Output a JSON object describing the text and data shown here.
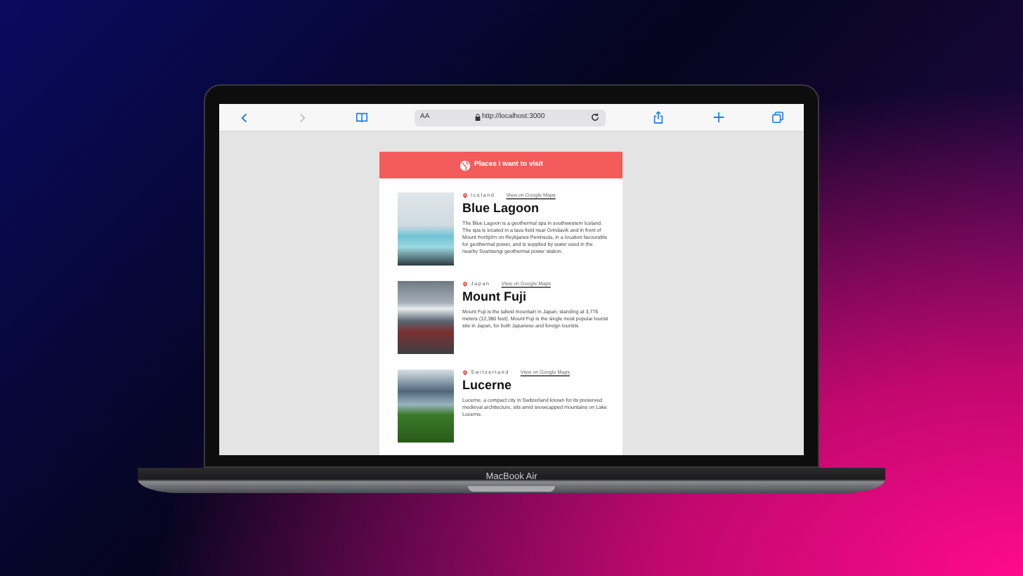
{
  "browser": {
    "back_disabled": false,
    "forward_disabled": true,
    "reader_label": "AA",
    "url": "http://localhost:3000"
  },
  "page": {
    "header": "Places I want to visit",
    "places": [
      {
        "country": "Iceland",
        "map_link": "View on Google Maps",
        "title": "Blue Lagoon",
        "description": "The Blue Lagoon is a geothermal spa in southwestern Iceland. The spa is located in a lava field near Grindavík and in front of Mount Þorbjörn on Reykjanes Peninsula, in a location favourable for geothermal power, and is supplied by water used in the nearby Svartsengi geothermal power station.",
        "kind": "lagoon"
      },
      {
        "country": "Japan",
        "map_link": "View on Google Maps",
        "title": "Mount Fuji",
        "description": "Mount Fuji is the tallest mountain in Japan, standing at 3,776 meters (12,380 feet). Mount Fuji is the single most popular tourist site in Japan, for both Japanese and foreign tourists.",
        "kind": "mountain"
      },
      {
        "country": "Switzerland",
        "map_link": "View on Google Maps",
        "title": "Lucerne",
        "description": "Lucerne, a compact city in Switzerland known for its preserved medieval architecture, sits amid snowcapped mountains on Lake Lucerne.",
        "kind": "lake"
      }
    ]
  },
  "device": {
    "label": "MacBook Air"
  }
}
